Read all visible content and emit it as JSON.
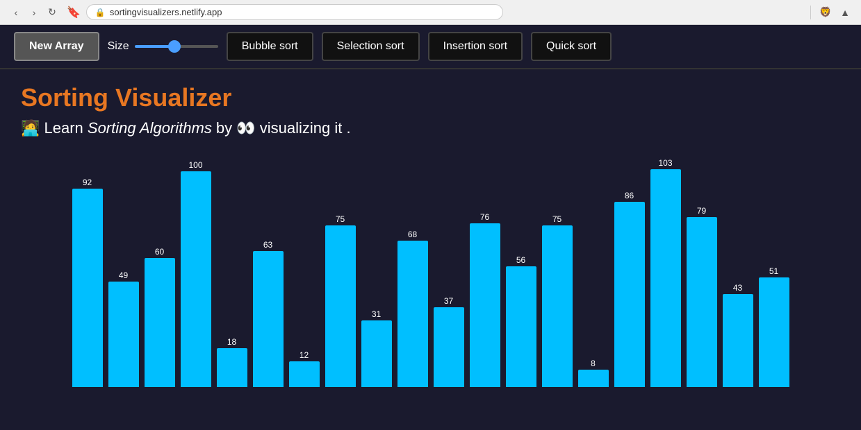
{
  "browser": {
    "url": "sortingvisualizers.netlify.app",
    "lock_symbol": "🔒"
  },
  "toolbar": {
    "new_array_label": "New Array",
    "size_label": "Size",
    "bubble_sort_label": "Bubble sort",
    "selection_sort_label": "Selection sort",
    "insertion_sort_label": "Insertion sort",
    "quick_sort_label": "Quick sort",
    "slider_value": 50
  },
  "main": {
    "title": "Sorting Visualizer",
    "subtitle_prefix": "🧑‍💻 Learn ",
    "subtitle_italic": "Sorting Algorithms",
    "subtitle_middle": " by 👀 visualizing it .",
    "accent_color": "#e87722",
    "bar_color": "#00bfff"
  },
  "chart": {
    "max_value": 103,
    "bars": [
      {
        "value": 92
      },
      {
        "value": 49
      },
      {
        "value": 60
      },
      {
        "value": 100
      },
      {
        "value": 18
      },
      {
        "value": 63
      },
      {
        "value": 12
      },
      {
        "value": 75
      },
      {
        "value": 31
      },
      {
        "value": 68
      },
      {
        "value": 37
      },
      {
        "value": 76
      },
      {
        "value": 56
      },
      {
        "value": 75
      },
      {
        "value": 8
      },
      {
        "value": 86
      },
      {
        "value": 103
      },
      {
        "value": 79
      },
      {
        "value": 43
      },
      {
        "value": 51
      }
    ]
  }
}
